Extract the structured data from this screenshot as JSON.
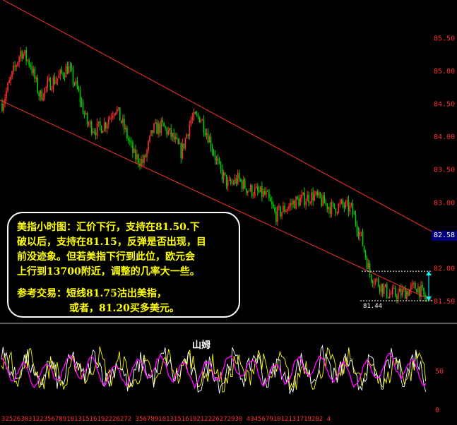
{
  "chart_data": [
    {
      "type": "candlestick",
      "panel": "price",
      "yticks": [
        "85.50",
        "85.00",
        "84.50",
        "84.00",
        "83.50",
        "83.00",
        "82.50",
        "82.00",
        "81.50"
      ],
      "ylim": [
        81.35,
        85.75
      ],
      "current_price": "82.58",
      "low_annotation": "81.44",
      "channel_lines": {
        "upper": {
          "start": 86.1,
          "end": 82.55
        },
        "lower": {
          "start": 84.55,
          "end": 81.5
        }
      },
      "support_levels": [
        81.95,
        81.5
      ],
      "close_trend": [
        84.5,
        84.9,
        85.3,
        85.1,
        84.6,
        84.8,
        84.9,
        85.05,
        84.7,
        84.2,
        84.1,
        84.2,
        84.45,
        84.1,
        83.7,
        83.6,
        84.1,
        84.15,
        84.0,
        83.75,
        84.25,
        84.3,
        83.95,
        83.5,
        83.25,
        83.35,
        83.2,
        83.15,
        83.1,
        82.8,
        82.9,
        83.0,
        83.05,
        83.1,
        83.0,
        82.9,
        82.95,
        82.9,
        82.5,
        81.9,
        81.75,
        81.6,
        81.6,
        81.65,
        81.72,
        81.5
      ]
    },
    {
      "type": "line",
      "panel": "oscillator",
      "yticks": [
        "50",
        "0"
      ],
      "ylim": [
        0,
        100
      ],
      "series_colors": [
        "#ffff00",
        "#ffffff",
        "#ff00ff"
      ],
      "xticks": "3252630312235678910131516192226272 3567891013151619212226272930 43456791012131719202 4"
    }
  ],
  "note": {
    "lines": [
      "美指小时图：汇价下行，支持在81.50.下",
      "破以后，支持在81.15，反弹是否出现，目",
      "前没迹象。但若美指下行到此位，欧元会",
      "上行到13700附近，调整的几率大一些。"
    ],
    "trade_lines": [
      "参考交易：短线81.75沽出美指，",
      "或者，81.20买多美元。"
    ]
  },
  "osc_title": "山姆",
  "colors": {
    "up": "#ff3030",
    "down": "#00cc00",
    "channel": "#ff3030",
    "axis_text": "#ff3030",
    "arrow": "#00ffff",
    "note_text": "#ffff00"
  }
}
